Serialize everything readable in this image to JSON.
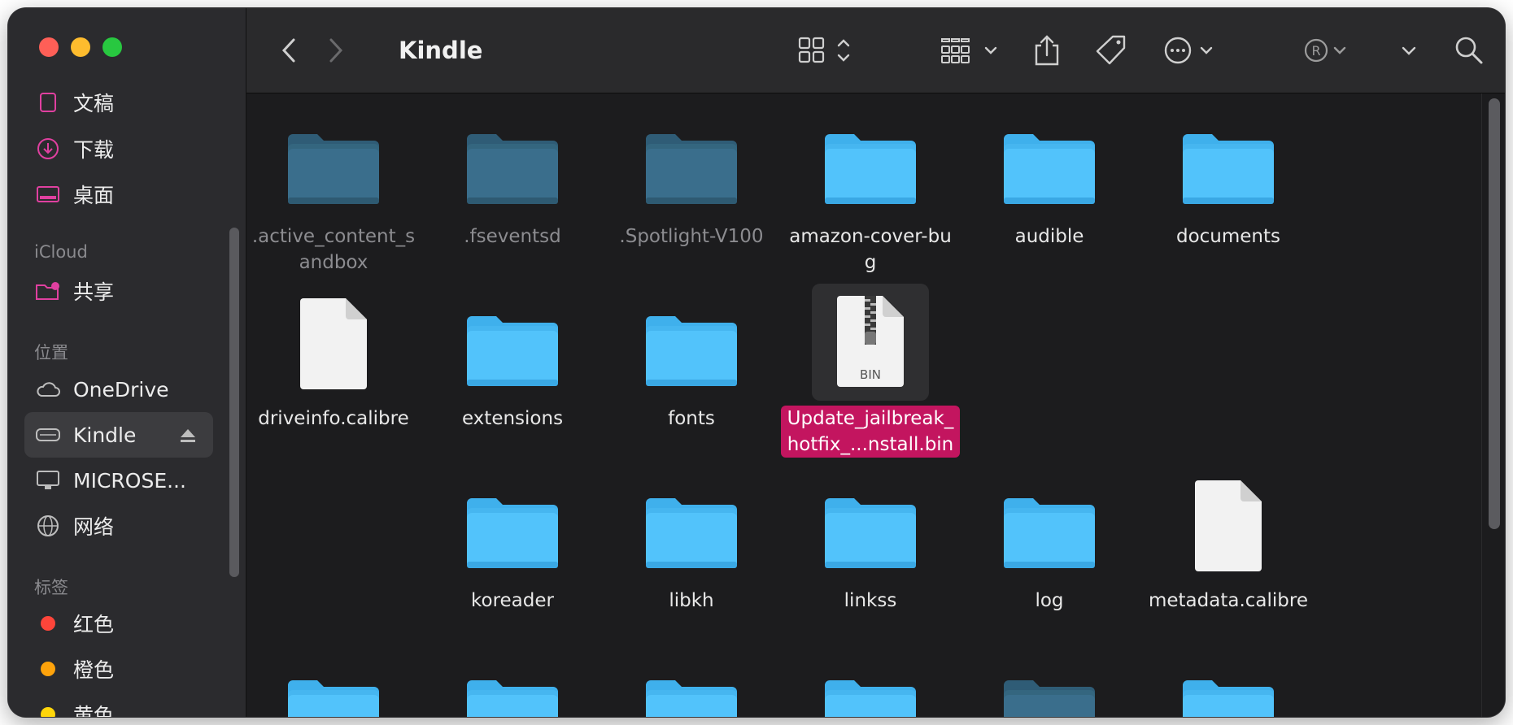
{
  "window": {
    "title": "Kindle"
  },
  "sidebar": {
    "items_top": [
      {
        "label": "文稿",
        "icon": "document-icon"
      },
      {
        "label": "下载",
        "icon": "download-icon"
      },
      {
        "label": "桌面",
        "icon": "desktop-icon"
      }
    ],
    "icloud_header": "iCloud",
    "icloud_items": [
      {
        "label": "共享",
        "icon": "shared-folder-icon"
      }
    ],
    "locations_header": "位置",
    "locations": [
      {
        "label": "OneDrive",
        "icon": "cloud-icon"
      },
      {
        "label": "Kindle",
        "icon": "drive-icon",
        "selected": true
      },
      {
        "label": "MICROSE...",
        "icon": "display-icon"
      },
      {
        "label": "网络",
        "icon": "network-icon"
      }
    ],
    "tags_header": "标签",
    "tags": [
      {
        "label": "红色",
        "color": "#fe453a"
      },
      {
        "label": "橙色",
        "color": "#fea30b"
      },
      {
        "label": "黄色",
        "color": "#ffd60a"
      }
    ]
  },
  "files": [
    {
      "name": ".active_content_sandbox",
      "kind": "folder",
      "hidden": true
    },
    {
      "name": ".fseventsd",
      "kind": "folder",
      "hidden": true
    },
    {
      "name": ".Spotlight-V100",
      "kind": "folder",
      "hidden": true
    },
    {
      "name": "amazon-cover-bug",
      "kind": "folder"
    },
    {
      "name": "audible",
      "kind": "folder"
    },
    {
      "name": "documents",
      "kind": "folder"
    },
    {
      "name": "driveinfo.calibre",
      "kind": "document"
    },
    {
      "name": "extensions",
      "kind": "folder"
    },
    {
      "name": "fonts",
      "kind": "folder"
    },
    {
      "name": "Update_jailbreak_hotfix_...nstall.bin",
      "kind": "bin",
      "selected": true,
      "badge": "BIN"
    },
    {
      "name": "koreader",
      "kind": "folder"
    },
    {
      "name": "libkh",
      "kind": "folder"
    },
    {
      "name": "linkss",
      "kind": "folder"
    },
    {
      "name": "log",
      "kind": "folder"
    },
    {
      "name": "metadata.calibre",
      "kind": "document"
    }
  ],
  "colors": {
    "folder": "#52c3fb",
    "folder_dim": "#3a6e8c",
    "selection": "#c3155f"
  }
}
